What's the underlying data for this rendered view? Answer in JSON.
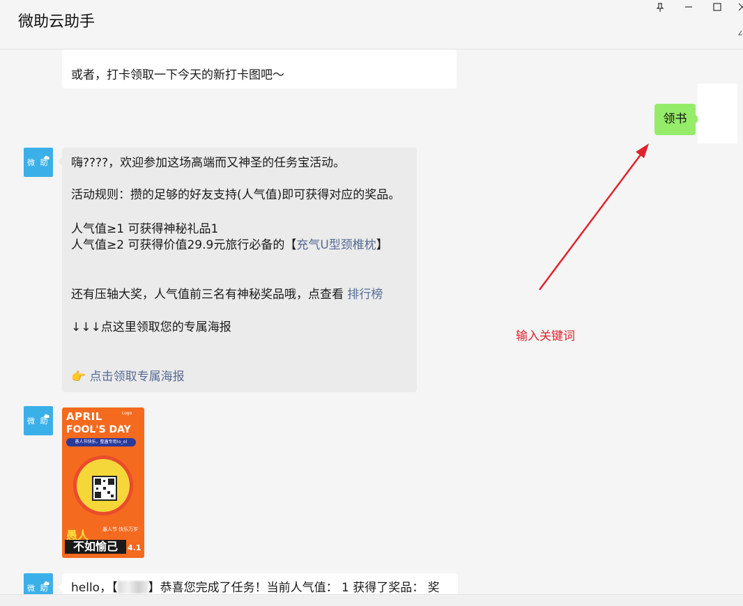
{
  "window": {
    "title": "微助云助手"
  },
  "messages": {
    "prev_bubble": {
      "text": "或者，打卡领取一下今天的新打卡图吧～"
    },
    "my_message": {
      "text": "领书"
    },
    "bot_welcome": {
      "avatar_text": "微 助",
      "greeting": "嗨????，欢迎参加这场高端而又神圣的任务宝活动。",
      "rules": "活动规则：攒的足够的好友支持(人气值)即可获得对应的奖品。",
      "prize1": "人气值≥1 可获得神秘礼品1",
      "prize2_prefix": "人气值≥2 可获得价值29.9元旅行必备的【",
      "prize2_link": "充气U型颈椎枕",
      "prize2_suffix": "】",
      "rank_prefix": "还有压轴大奖，人气值前三名有神秘奖品哦，点查看 ",
      "rank_link": "排行榜",
      "poster_hint": "↓↓↓点这里领取您的专属海报",
      "poster_link_emoji": "👉",
      "poster_link": "点击领取专属海报"
    },
    "poster": {
      "avatar_text": "微 助",
      "title_line1": "APRIL",
      "title_line2": "FOOL'S DAY",
      "logo": "Logo",
      "banner": "愚人节快乐，整蛊专用(o_o)",
      "bottom1": "愚人",
      "bottom2": "不如愉己",
      "date": "4.1",
      "side_text": "愚人节 快乐万岁"
    },
    "completion": {
      "avatar_text": "微 助",
      "prefix": "hello，【",
      "suffix": "】恭喜您完成了任务！当前人气值： 1 获得了奖品： 奖"
    }
  },
  "annotation": {
    "text": "输入关键词",
    "color": "#e0222d"
  },
  "colors": {
    "my_bubble": "#95ec69",
    "link": "#576b95",
    "avatar": "#3bb0e8"
  }
}
